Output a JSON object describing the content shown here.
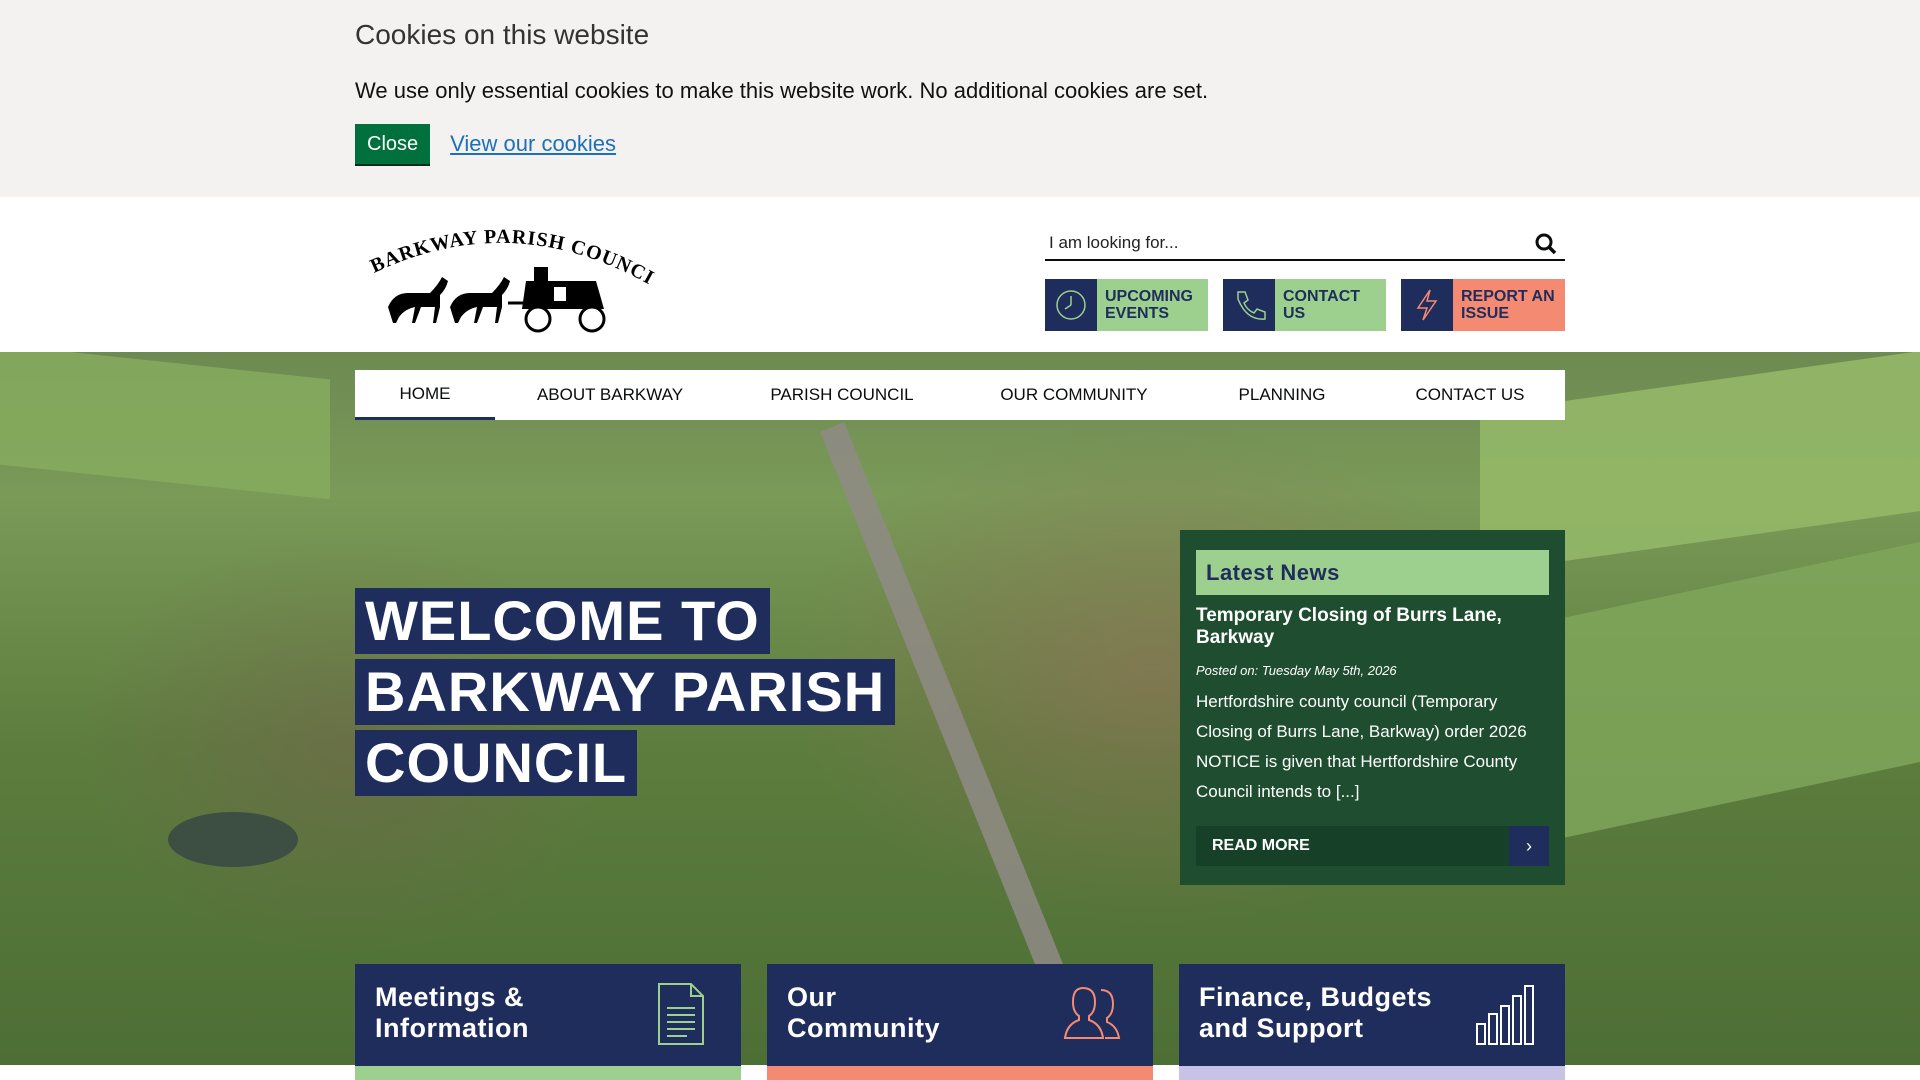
{
  "cookie_banner": {
    "title": "Cookies on this website",
    "message": "We use only essential cookies to make this website work. No additional cookies are set.",
    "close_label": "Close",
    "view_link": "View our cookies"
  },
  "header": {
    "logo_text": "BARKWAY PARISH COUNCIL",
    "search_placeholder": "I am looking for...",
    "quick_links": [
      {
        "label": "UPCOMING EVENTS",
        "icon": "clock-icon"
      },
      {
        "label": "CONTACT US",
        "icon": "phone-icon"
      },
      {
        "label": "REPORT AN ISSUE",
        "icon": "lightning-icon"
      }
    ]
  },
  "nav": {
    "items": [
      "HOME",
      "ABOUT BARKWAY",
      "PARISH COUNCIL",
      "OUR COMMUNITY",
      "PLANNING",
      "CONTACT US"
    ]
  },
  "hero": {
    "welcome_lines": [
      "WELCOME TO",
      "BARKWAY PARISH",
      "COUNCIL"
    ]
  },
  "news": {
    "heading": "Latest News",
    "title": "Temporary Closing of Burrs Lane, Barkway",
    "posted": "Posted on: Tuesday May 5th, 2026",
    "excerpt": "Hertfordshire county council (Temporary Closing of Burrs Lane, Barkway) order 2026  NOTICE is given that Hertfordshire County Council intends to [...]",
    "read_more": "READ MORE"
  },
  "cards": [
    {
      "line1": "Meetings &",
      "line2": "Information",
      "icon": "document-icon"
    },
    {
      "line1": "Our",
      "line2": "Community",
      "icon": "people-icon"
    },
    {
      "line1": "Finance, Budgets",
      "line2": "and Support",
      "icon": "bar-chart-icon"
    }
  ],
  "colors": {
    "navy": "#1f2d5c",
    "green": "#9dd08f",
    "coral": "#f58a72",
    "lavender": "#c6c3e6",
    "news_bg": "#1f4d2f",
    "cookie_button": "#00703c",
    "link": "#1d70b8"
  }
}
